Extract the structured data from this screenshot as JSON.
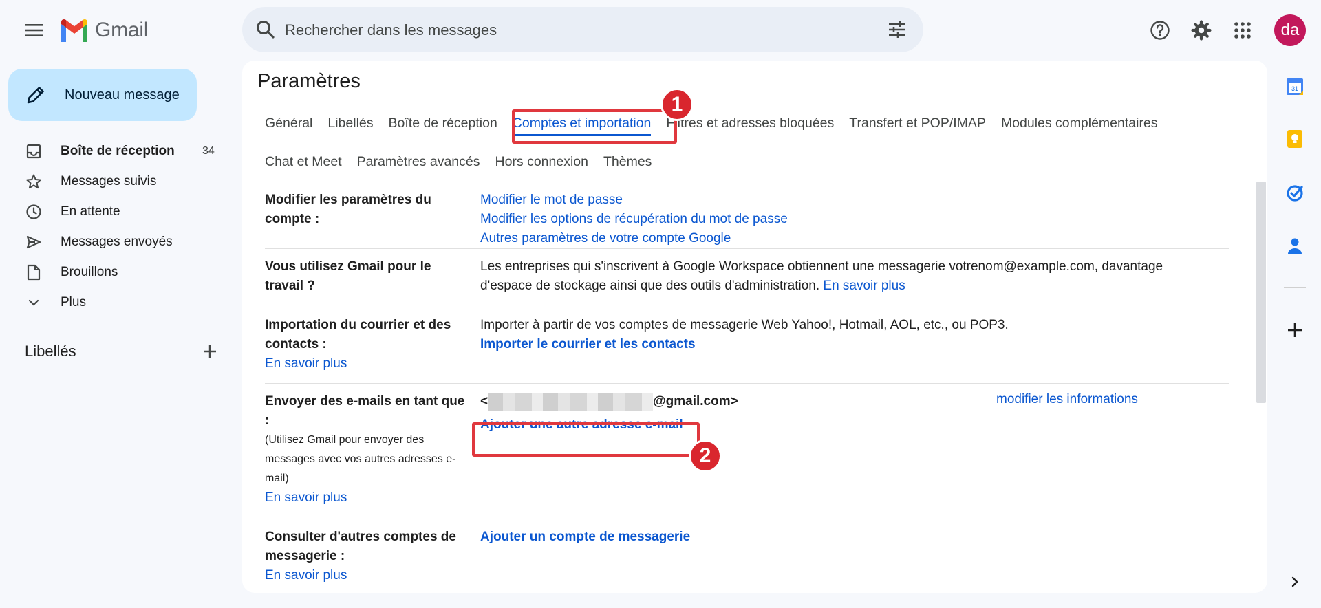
{
  "app": {
    "name": "Gmail"
  },
  "search": {
    "placeholder": "Rechercher dans les messages"
  },
  "user": {
    "initials": "da"
  },
  "compose": {
    "label": "Nouveau message"
  },
  "nav": {
    "items": [
      {
        "label": "Boîte de réception",
        "count": "34",
        "icon": "inbox-icon"
      },
      {
        "label": "Messages suivis",
        "icon": "star-icon"
      },
      {
        "label": "En attente",
        "icon": "clock-icon"
      },
      {
        "label": "Messages envoyés",
        "icon": "send-icon"
      },
      {
        "label": "Brouillons",
        "icon": "draft-icon"
      },
      {
        "label": "Plus",
        "icon": "chevron-down-icon"
      }
    ]
  },
  "labels": {
    "header": "Libellés"
  },
  "settings": {
    "title": "Paramètres",
    "tabs": [
      "Général",
      "Libellés",
      "Boîte de réception",
      "Comptes et importation",
      "Filtres et adresses bloquées",
      "Transfert et POP/IMAP",
      "Modules complémentaires",
      "Chat et Meet",
      "Paramètres avancés",
      "Hors connexion",
      "Thèmes"
    ],
    "rows": {
      "account": {
        "label": "Modifier les paramètres du compte :",
        "links": [
          "Modifier le mot de passe",
          "Modifier les options de récupération du mot de passe",
          "Autres paramètres de votre compte Google"
        ]
      },
      "work": {
        "label": "Vous utilisez Gmail pour le travail ?",
        "text": "Les entreprises qui s'inscrivent à Google Workspace obtiennent une messagerie votrenom@example.com, davantage d'espace de stockage ainsi que des outils d'administration.",
        "link": "En savoir plus"
      },
      "import": {
        "label": "Importation du courrier et des contacts :",
        "learn_more": "En savoir plus",
        "text": "Importer à partir de vos comptes de messagerie Web Yahoo!, Hotmail, AOL, etc., ou POP3.",
        "action": "Importer le courrier et les contacts"
      },
      "send_as": {
        "label": "Envoyer des e-mails en tant que :",
        "sub": "(Utilisez Gmail pour envoyer des messages avec vos autres adresses e-mail)",
        "learn_more": "En savoir plus",
        "email_prefix": "<",
        "email_suffix": "@gmail.com>",
        "edit": "modifier les informations",
        "action": "Ajouter une autre adresse e-mail"
      },
      "other_accounts": {
        "label": "Consulter d'autres comptes de messagerie :",
        "learn_more": "En savoir plus",
        "action": "Ajouter un compte de messagerie"
      }
    }
  },
  "annotations": {
    "badge1": "1",
    "badge2": "2"
  },
  "colors": {
    "accent": "#0b57d0",
    "compose_bg": "#c2e7ff",
    "highlight": "#e0383e",
    "avatar": "#c2185b"
  }
}
